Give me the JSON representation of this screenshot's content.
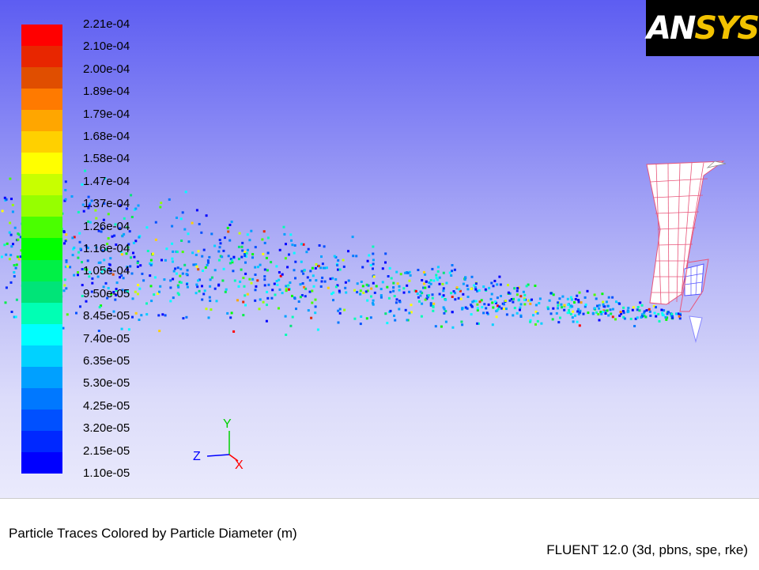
{
  "logo": {
    "text": "ANSYS",
    "prefix": "AN",
    "suffix": "SYS"
  },
  "legend": {
    "values": [
      "2.21e-04",
      "2.10e-04",
      "2.00e-04",
      "1.89e-04",
      "1.79e-04",
      "1.68e-04",
      "1.58e-04",
      "1.47e-04",
      "1.37e-04",
      "1.26e-04",
      "1.16e-04",
      "1.05e-04",
      "9.50e-05",
      "8.45e-05",
      "7.40e-05",
      "6.35e-05",
      "5.30e-05",
      "4.25e-05",
      "3.20e-05",
      "2.15e-05",
      "1.10e-05"
    ],
    "colors": [
      "#ff0000",
      "#e82600",
      "#e04e00",
      "#ff7a00",
      "#ffa600",
      "#ffd000",
      "#ffff00",
      "#c8ff00",
      "#96ff00",
      "#4aff00",
      "#00ff00",
      "#00f046",
      "#00e478",
      "#00ffb4",
      "#00ffff",
      "#00d2ff",
      "#00a0ff",
      "#0078ff",
      "#0050ff",
      "#0028ff",
      "#0000ff"
    ]
  },
  "axes": {
    "x": "X",
    "y": "Y",
    "z": "Z"
  },
  "colors": {
    "x_axis": "#ff0000",
    "y_axis": "#00d200",
    "z_axis": "#0000ff",
    "mesh": "#e8557a"
  },
  "footer": {
    "title": "Particle Traces Colored by Particle Diameter (m)",
    "solver": "FLUENT 12.0 (3d, pbns, spe, rke)"
  }
}
